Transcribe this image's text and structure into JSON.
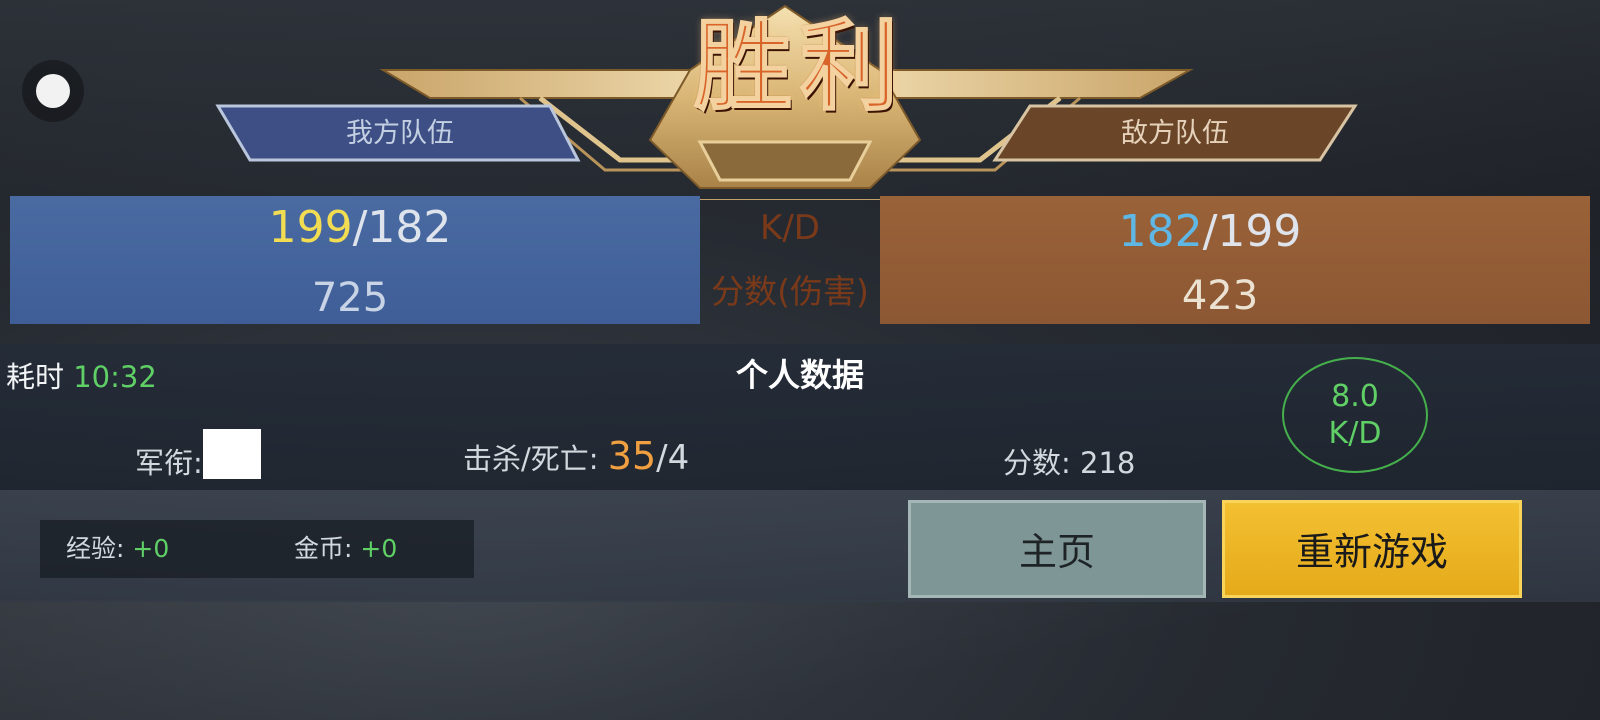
{
  "result_title": "胜利",
  "teams": {
    "ally_label": "我方队伍",
    "enemy_label": "敌方队伍"
  },
  "stats": {
    "kd_label": "K/D",
    "score_label": "分数(伤害)",
    "ally": {
      "kills": "199",
      "deaths": "/182",
      "score": "725"
    },
    "enemy": {
      "kills": "182",
      "deaths": "/199",
      "score": "423"
    }
  },
  "personal": {
    "title": "个人数据",
    "time_label": "耗时 ",
    "time_value": "10:32",
    "rank_label": "军衔:",
    "kd_label": "击杀/死亡: ",
    "kills": "35",
    "deaths": "/4",
    "score_label": "分数: ",
    "score_value": "218",
    "kd_ratio": "8.0",
    "kd_ratio_label": "K/D"
  },
  "rewards": {
    "exp_label": "经验: ",
    "exp_value": "+0",
    "gold_label": "金币: ",
    "gold_value": "+0"
  },
  "buttons": {
    "home": "主页",
    "replay": "重新游戏"
  },
  "colors": {
    "ally_band": "#4a6aa2",
    "enemy_band": "#9a6238",
    "gold": "#e7c98a",
    "victory": "#d8642a",
    "green": "#5fcf66",
    "replay_button": "#f3c032"
  }
}
